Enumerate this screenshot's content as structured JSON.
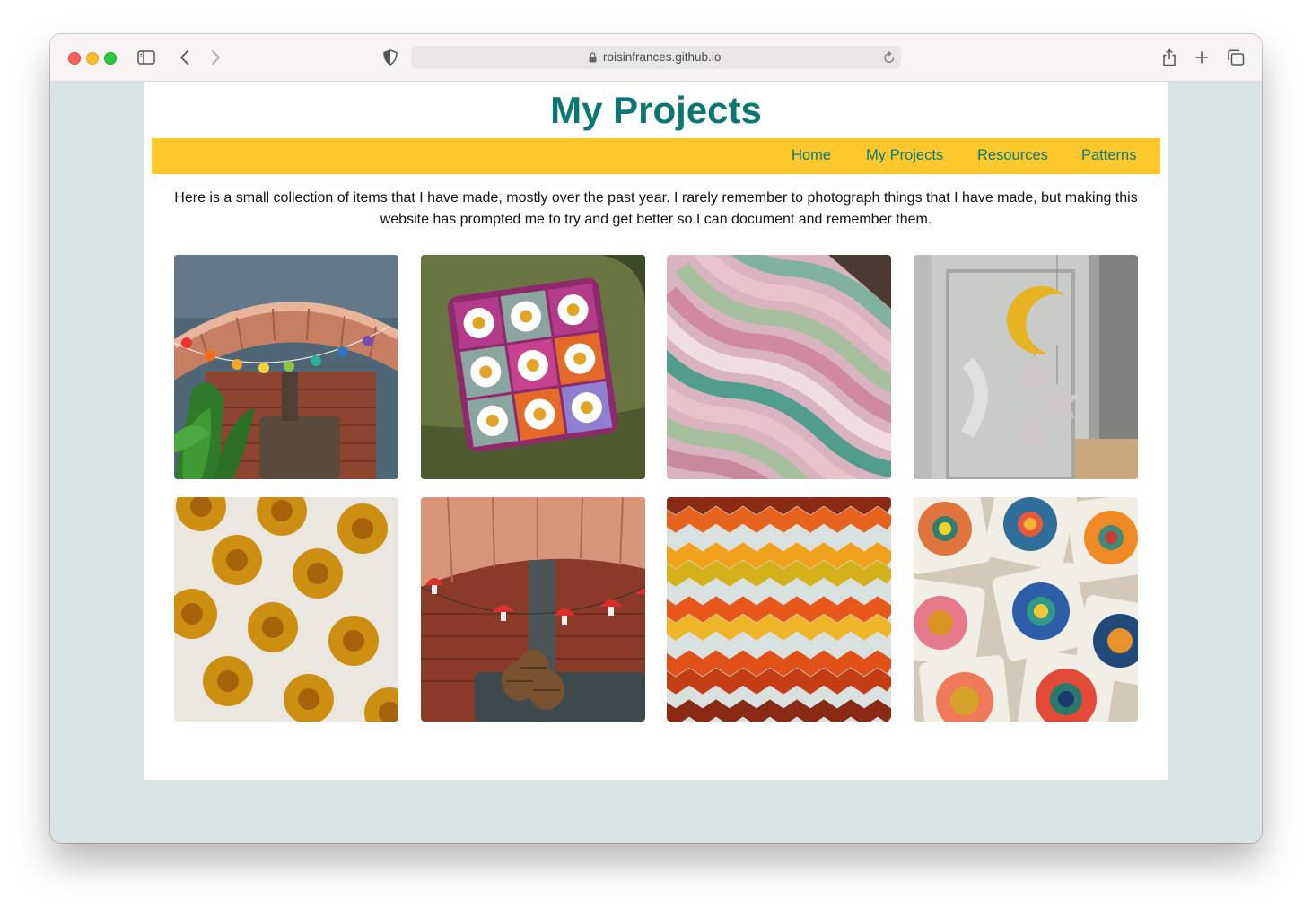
{
  "browser": {
    "url": "roisinfrances.github.io",
    "icons": {
      "sidebar": "sidebar-icon",
      "back": "chevron-left-icon",
      "forward": "chevron-right-icon",
      "privacy": "shield-icon",
      "lock": "lock-icon",
      "reload": "reload-icon",
      "share": "share-icon",
      "new_tab": "plus-icon",
      "tabs": "tab-overview-icon"
    }
  },
  "page": {
    "title": "My Projects",
    "nav": [
      "Home",
      "My Projects",
      "Resources",
      "Patterns"
    ],
    "intro": "Here is a small collection of items that I have made, mostly over the past year. I rarely remember to photograph things that I have made, but making this website has prompted me to try and get better so I can document and remember them.",
    "gallery": [
      {
        "subject": "rainbow flower bunting over fireplace"
      },
      {
        "subject": "daisy granny square cushion"
      },
      {
        "subject": "pastel ripple blanket"
      },
      {
        "subject": "moon and stars mobile"
      },
      {
        "subject": "sunflower hexagon blanket"
      },
      {
        "subject": "toadstool garland over fireplace"
      },
      {
        "subject": "autumn ripple blanket"
      },
      {
        "subject": "sunburst granny squares"
      }
    ]
  },
  "colors": {
    "brand_teal": "#0b7772",
    "nav_yellow": "#fec72c",
    "backdrop": "#d9e5e4"
  }
}
